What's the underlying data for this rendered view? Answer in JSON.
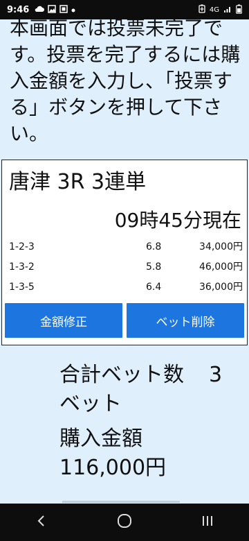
{
  "status_bar": {
    "time": "9:46",
    "left_icons": [
      "cloud-icon",
      "image-icon",
      "screenshot-icon",
      "dot-icon"
    ],
    "right_icons": [
      "battery-saver-icon",
      "4g-lte-icon",
      "signal-icon",
      "battery-icon"
    ],
    "network_label": "4G"
  },
  "notice": {
    "text": "本画面では投票未完了です。投票を完了するには購入金額を入力し、「投票する」ボタンを押して下さい。"
  },
  "bet_card": {
    "title": "唐津 3R 3連単",
    "odds_time": "09時45分現在",
    "bets": [
      {
        "combo": "1-2-3",
        "odds": "6.8",
        "amount": "34,000円"
      },
      {
        "combo": "1-3-2",
        "odds": "5.8",
        "amount": "46,000円"
      },
      {
        "combo": "1-3-5",
        "odds": "6.4",
        "amount": "36,000円"
      }
    ],
    "edit_amount_label": "金額修正",
    "delete_bet_label": "ベット削除"
  },
  "summary": {
    "total_bets_label": "合計ベット数",
    "total_bets_value": "3",
    "total_bets_unit": "ベット",
    "purchase_amount_label": "購入金額",
    "purchase_amount_value": "116,000円"
  },
  "colors": {
    "background": "#dfeffb",
    "button": "#1d75e0",
    "system_bar": "#0d0d0d"
  }
}
